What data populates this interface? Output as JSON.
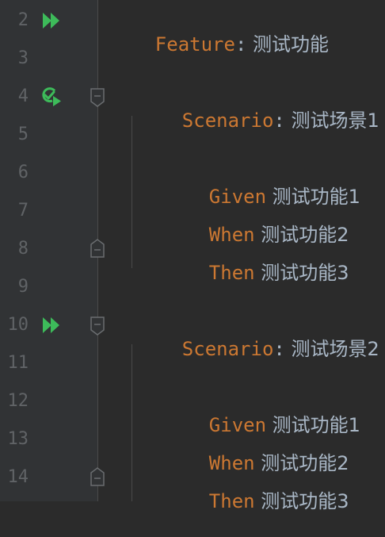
{
  "gutter": {
    "line_numbers": [
      "2",
      "3",
      "4",
      "5",
      "6",
      "7",
      "8",
      "9",
      "10",
      "11",
      "12",
      "13",
      "14"
    ],
    "icons": {
      "run_all": "double-play-icon",
      "run_scenario_status": "run-passed-icon",
      "fold_open": "fold-start-icon",
      "fold_close": "fold-end-icon"
    }
  },
  "code": {
    "feature": {
      "keyword": "Feature",
      "colon": ":",
      "text": " 测试功能"
    },
    "scenario1": {
      "keyword": "Scenario",
      "colon": ":",
      "text": " 测试场景1",
      "steps": [
        {
          "keyword": "Given",
          "text": " 测试功能1"
        },
        {
          "keyword": "When",
          "text": " 测试功能2"
        },
        {
          "keyword": "Then",
          "text": " 测试功能3"
        }
      ]
    },
    "scenario2": {
      "keyword": "Scenario",
      "colon": ":",
      "text": " 测试场景2",
      "steps": [
        {
          "keyword": "Given",
          "text": " 测试功能1"
        },
        {
          "keyword": "When",
          "text": " 测试功能2"
        },
        {
          "keyword": "Then",
          "text": " 测试功能3"
        }
      ]
    }
  },
  "colors": {
    "keyword": "#cc7832",
    "text": "#a9b7c6",
    "line_number": "#606366",
    "run_icon": "#3dbb5a",
    "gutter_bg": "#313335",
    "editor_bg": "#2b2b2b"
  }
}
